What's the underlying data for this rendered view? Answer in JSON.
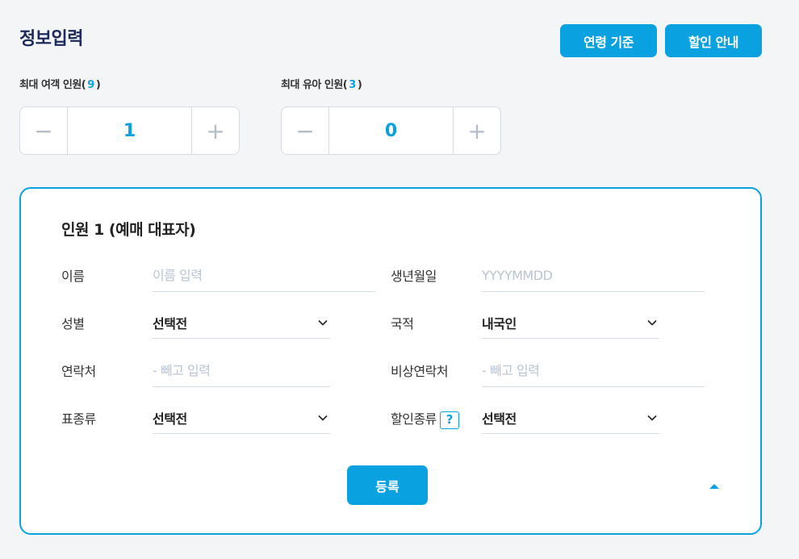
{
  "header": {
    "title": "정보입력",
    "age_button": "연령 기준",
    "discount_button": "할인 안내"
  },
  "adult": {
    "label_prefix": "최대 여객 인원(",
    "max": "9",
    "label_suffix": ")",
    "minus": "−",
    "value": "1",
    "plus": "+"
  },
  "infant": {
    "label_prefix": "최대 유아 인원(",
    "max": "3",
    "label_suffix": ")",
    "minus": "−",
    "value": "0",
    "plus": "+"
  },
  "passenger": {
    "title": "인원 1 (예매 대표자)",
    "name": {
      "label": "이름",
      "value": "",
      "placeholder": "이름 입력"
    },
    "birth": {
      "label": "생년월일",
      "value": "",
      "placeholder": "YYYYMMDD"
    },
    "gender": {
      "label": "성별",
      "selected": "선택전"
    },
    "nationality": {
      "label": "국적",
      "selected": "내국인"
    },
    "phone": {
      "label": "연락처",
      "value": "",
      "placeholder": "- 빼고 입력"
    },
    "emergency": {
      "label": "비상연락처",
      "value": "",
      "placeholder": "- 빼고 입력"
    },
    "ticket_type": {
      "label": "표종류",
      "selected": "선택전"
    },
    "discount_type": {
      "label": "할인종류",
      "help": "?",
      "selected": "선택전"
    },
    "register_button": "등록"
  },
  "colors": {
    "accent": "#0aa1e0",
    "title": "#1d2a5b",
    "border": "#d5dbe3",
    "placeholder": "#b9c4d3"
  },
  "icons": {
    "minus": "minus-icon",
    "plus": "plus-icon",
    "dropdown": "chevron-down-icon",
    "collapse": "caret-up-icon",
    "help": "question-icon"
  }
}
